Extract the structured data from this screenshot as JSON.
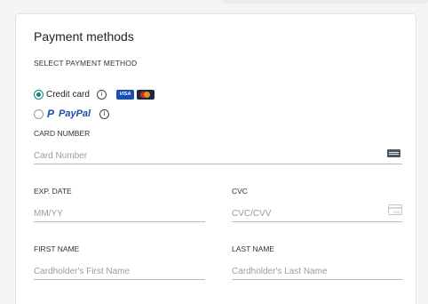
{
  "title": "Payment methods",
  "section_label": "SELECT PAYMENT METHOD",
  "options": {
    "credit_card": {
      "label": "Credit card",
      "selected": true
    },
    "paypal": {
      "label": "PayPal",
      "selected": false
    }
  },
  "card_logos": {
    "visa": "VISA"
  },
  "info_glyph": "i",
  "fields": {
    "card_number": {
      "label": "CARD NUMBER",
      "placeholder": "Card Number"
    },
    "exp_date": {
      "label": "EXP. DATE",
      "placeholder": "MM/YY"
    },
    "cvc": {
      "label": "CVC",
      "placeholder": "CVC/CVV",
      "icon_text": "CVC"
    },
    "first_name": {
      "label": "FIRST NAME",
      "placeholder": "Cardholder's First Name"
    },
    "last_name": {
      "label": "LAST NAME",
      "placeholder": "Cardholder's Last Name"
    }
  },
  "colors": {
    "accent": "#0e8a7b",
    "paypal_blue": "#1e4fa8",
    "visa_blue": "#1a4db3"
  }
}
